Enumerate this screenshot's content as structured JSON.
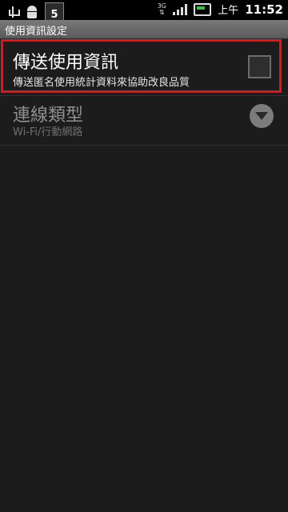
{
  "status_bar": {
    "notification_number": "5",
    "network_type": "3G",
    "ampm": "上午",
    "time": "11:52"
  },
  "title_bar": {
    "title": "使用資訊設定"
  },
  "settings": [
    {
      "title": "傳送使用資訊",
      "subtitle": "傳送匿名使用統計資料來協助改良品質",
      "checked": false
    },
    {
      "title": "連線類型",
      "subtitle": "Wi-Fi/行動網路",
      "enabled": false
    }
  ],
  "colors": {
    "highlight": "#e11111",
    "background": "#1c1c1c",
    "battery": "#3ec33e"
  }
}
